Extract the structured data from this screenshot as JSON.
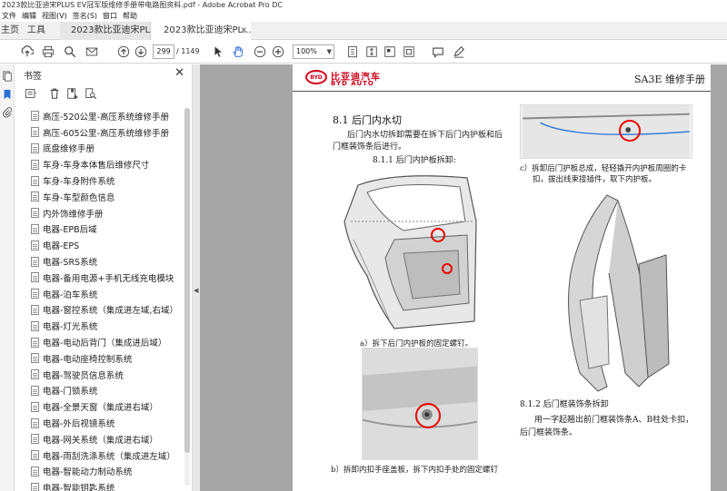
{
  "window": {
    "title": "2023款比亚迪宋PLUS EV冠军版维修手册带电路图资料.pdf - Adobe Acrobat Pro DC"
  },
  "menu": [
    "文件",
    "编辑",
    "视图(V)",
    "签名(S)",
    "窗口",
    "帮助"
  ],
  "tabs": {
    "home": "主页",
    "tools": "工具",
    "doc1": "2023款比亚迪宋PL...",
    "doc2": "2023款比亚迪宋PL..."
  },
  "toolbar": {
    "page_current": "299",
    "page_total": "/ 1149",
    "zoom": "100%"
  },
  "bookmarks": {
    "header": "书签",
    "items": [
      "高压-520公里-高压系统维修手册",
      "高压-605公里-高压系统维修手册",
      "底盘维修手册",
      "车身-车身本体售后维修尺寸",
      "车身-车身附件系统",
      "车身-车型颜色信息",
      "内外饰维修手册",
      "电器-EPB后域",
      "电器-EPS",
      "电器-SRS系统",
      "电器-备用电源+手机无线充电模块",
      "电器-泊车系统",
      "电器-窗控系统（集成进左域,右域）",
      "电器-灯光系统",
      "电器-电动后背门（集成进后域）",
      "电器-电动座椅控制系统",
      "电器-驾驶员信息系统",
      "电器-门锁系统",
      "电器-全景天窗（集成进右域）",
      "电器-外后视镜系统",
      "电器-网关系统（集成进右域）",
      "电器-雨刮洗涤系统（集成进左域）",
      "电器-智能动力制动系统",
      "电器-智能钥匙系统"
    ]
  },
  "page": {
    "brand_cn": "比亚迪汽车",
    "brand_en": "BYD AUTO",
    "logo_text": "BYD",
    "manual_title": "SA3E 维修手册",
    "section_title": "8.1  后门内水切",
    "intro_line1": "后门内水切拆卸需要在拆下后门内护板和后",
    "intro_line2": "门框装饰条后进行。",
    "subsection": "8.1.1  后门内护板拆卸:",
    "caption_a": "a）拆下后门内护板的固定螺钉。",
    "caption_b": "b）拆卸内扣手座盖板，拆下内扣手处的固定螺钉",
    "caption_c_line1": "c）拆卸后门护板总成，轻轻撬开内护板周圈的卡",
    "caption_c_line2": "扣，拔出线束接插件，取下内护板。",
    "subsection2": "8.1.2  后门框装饰条拆卸",
    "para2_line1": "用一字起翘出前门框装饰条A、B柱处卡扣，",
    "para2_line2": "后门框装饰条。"
  },
  "colors": {
    "accent_red": "#d0021b",
    "viewer_bg": "#a6a6a6"
  }
}
